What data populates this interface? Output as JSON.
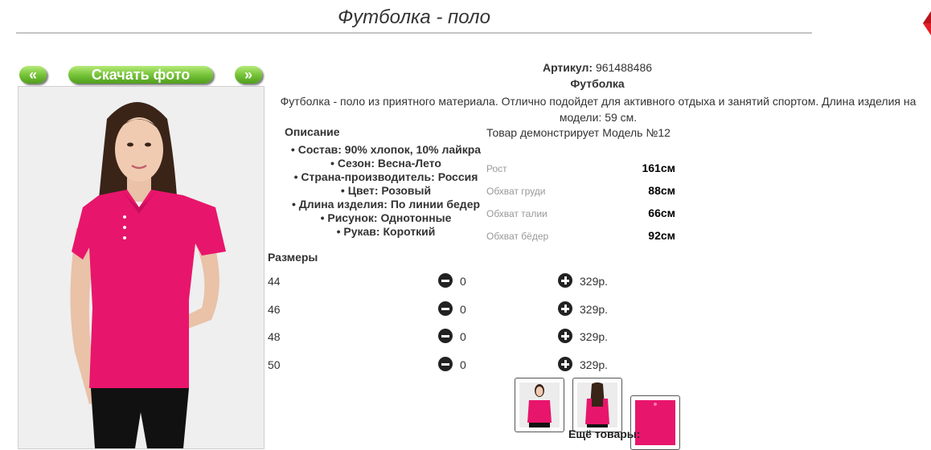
{
  "product": {
    "title": "Футболка - поло",
    "sku_label": "Артикул:",
    "sku_value": "961488486",
    "subname": "Футболка",
    "description": "Футболка - поло из приятного материала. Отлично подойдет для активного отдыха и занятий спортом. Длина изделия на модели: 59 см."
  },
  "gallery": {
    "prev_label": "«",
    "download_label": "Скачать фото",
    "next_label": "»",
    "thumbnails": [
      "front-view",
      "back-view",
      "fabric-swatch"
    ]
  },
  "specs": {
    "heading": "Описание",
    "items": [
      "Состав: 90% хлопок, 10% лайкра",
      "Сезон: Весна-Лето",
      "Страна-производитель: Россия",
      "Цвет: Розовый",
      "Длина изделия: По линии бедер",
      "Рисунок: Однотонные",
      "Рукав: Короткий"
    ]
  },
  "model": {
    "caption": "Товар демонстрирует Модель №12",
    "measurements": [
      {
        "label": "Рост",
        "value": "161см"
      },
      {
        "label": "Обхват груди",
        "value": "88см"
      },
      {
        "label": "Обхват талии",
        "value": "66см"
      },
      {
        "label": "Обхват бёдер",
        "value": "92см"
      }
    ]
  },
  "sizes": {
    "heading": "Размеры",
    "rows": [
      {
        "size": "44",
        "qty": "0",
        "price": "329р."
      },
      {
        "size": "46",
        "qty": "0",
        "price": "329р."
      },
      {
        "size": "48",
        "qty": "0",
        "price": "329р."
      },
      {
        "size": "50",
        "qty": "0",
        "price": "329р."
      }
    ]
  },
  "more_label": "Ещё товары:",
  "colors": {
    "accent_green": "#78c43a",
    "shirt_pink": "#e8156c",
    "corner_red": "#e0202a"
  }
}
